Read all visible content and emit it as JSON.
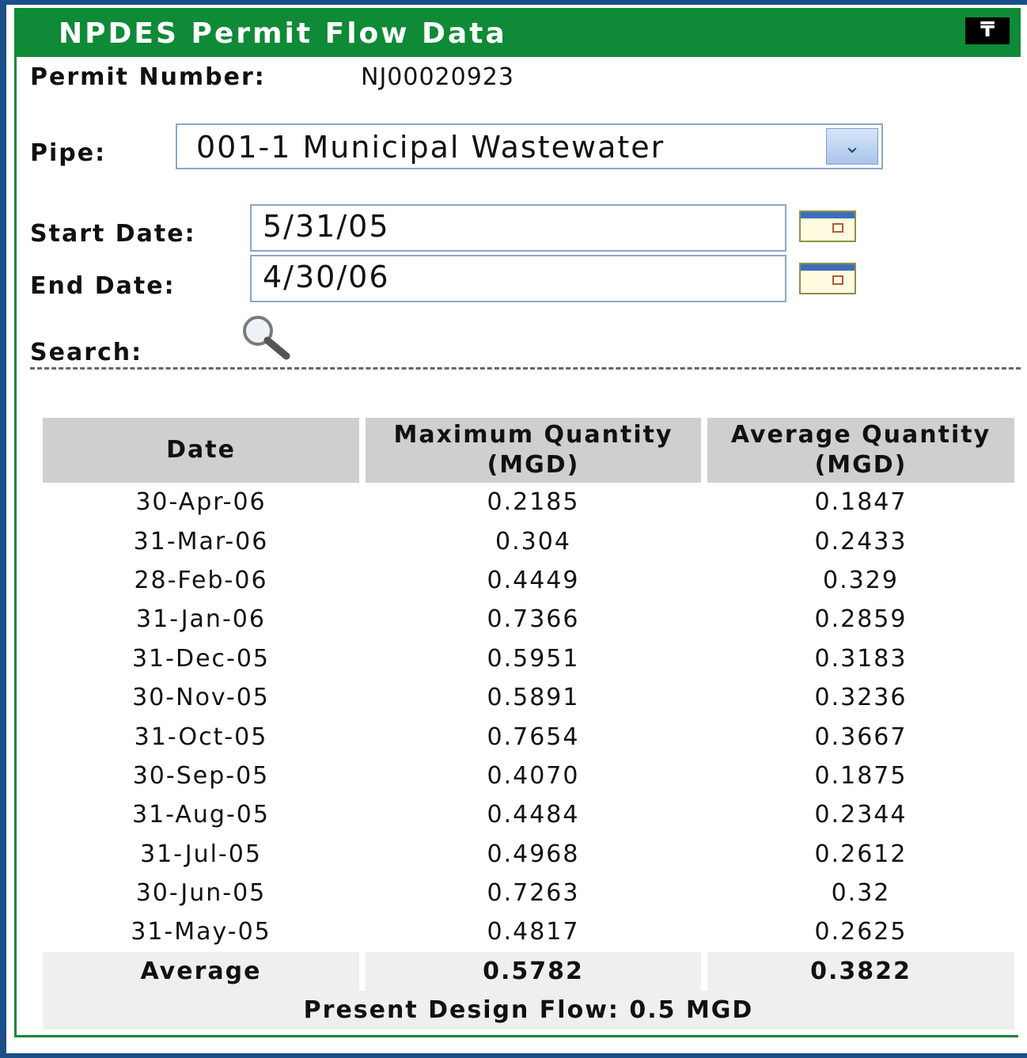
{
  "window": {
    "title": "NPDES Permit Flow Data",
    "pin_glyph": "₸"
  },
  "form": {
    "permit_label": "Permit Number:",
    "permit_value": "NJ00020923",
    "pipe_label": "Pipe:",
    "pipe_value": "001-1 Municipal Wastewater",
    "start_label": "Start Date:",
    "start_value": "5/31/05",
    "end_label": "End Date:",
    "end_value": "4/30/06",
    "search_label": "Search:"
  },
  "table": {
    "headers": [
      "Date",
      "Maximum Quantity (MGD)",
      "Average Quantity (MGD)"
    ],
    "rows": [
      [
        "30-Apr-06",
        "0.2185",
        "0.1847"
      ],
      [
        "31-Mar-06",
        "0.304",
        "0.2433"
      ],
      [
        "28-Feb-06",
        "0.4449",
        "0.329"
      ],
      [
        "31-Jan-06",
        "0.7366",
        "0.2859"
      ],
      [
        "31-Dec-05",
        "0.5951",
        "0.3183"
      ],
      [
        "30-Nov-05",
        "0.5891",
        "0.3236"
      ],
      [
        "31-Oct-05",
        "0.7654",
        "0.3667"
      ],
      [
        "30-Sep-05",
        "0.4070",
        "0.1875"
      ],
      [
        "31-Aug-05",
        "0.4484",
        "0.2344"
      ],
      [
        "31-Jul-05",
        "0.4968",
        "0.2612"
      ],
      [
        "30-Jun-05",
        "0.7263",
        "0.32"
      ],
      [
        "31-May-05",
        "0.4817",
        "0.2625"
      ]
    ],
    "average": [
      "Average",
      "0.5782",
      "0.3822"
    ],
    "design_flow": "Present Design Flow: 0.5 MGD"
  },
  "colors": {
    "title_bar": "#0f8a36",
    "header_cell": "#cfcfcf",
    "outer_background": "#1a4f8a"
  }
}
